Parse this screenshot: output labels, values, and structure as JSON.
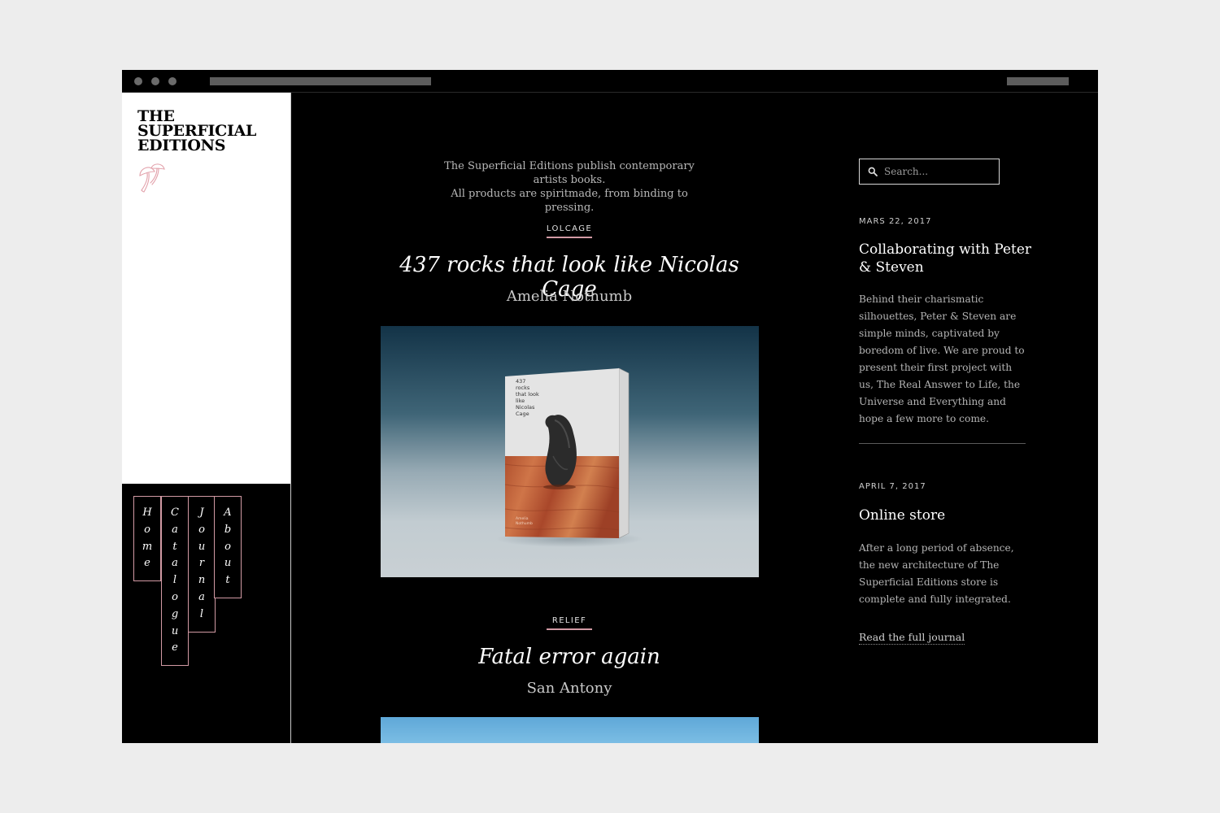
{
  "brand": {
    "logo_lines": [
      "THE",
      "SUPERFICIAL",
      "EDITIONS"
    ]
  },
  "nav": [
    {
      "label": "Home",
      "letters": [
        "H",
        "o",
        "m",
        "e"
      ]
    },
    {
      "label": "Catalogue",
      "letters": [
        "C",
        "a",
        "t",
        "a",
        "l",
        "o",
        "g",
        "u",
        "e"
      ]
    },
    {
      "label": "Journal",
      "letters": [
        "J",
        "o",
        "u",
        "r",
        "n",
        "a",
        "l"
      ]
    },
    {
      "label": "About",
      "letters": [
        "A",
        "b",
        "o",
        "u",
        "t"
      ]
    }
  ],
  "intro": {
    "line1": "The Superficial Editions publish contemporary artists books.",
    "line2": "All products are spiritmade, from binding to pressing."
  },
  "books": [
    {
      "category": "LOLCAGE",
      "title": "437 rocks that look like Nicolas Cage",
      "author": "Amelia Nothumb",
      "cover": {
        "lines": [
          "437",
          "rocks",
          "that look",
          "like",
          "Nicolas",
          "Cage"
        ],
        "author_lines": [
          "Amelia",
          "Nothumb"
        ]
      }
    },
    {
      "category": "RELIEF",
      "title": "Fatal error again",
      "author": "San Antony"
    }
  ],
  "search": {
    "placeholder": "Search..."
  },
  "journal": {
    "entries": [
      {
        "date": "MARS 22, 2017",
        "title": "Collaborating with Peter & Steven",
        "body": "Behind their charismatic silhouettes, Peter & Steven are simple minds, captivated by boredom of live. We are proud to present their first project with us, The Real Answer to Life, the Universe and Everything and hope a few more to come."
      },
      {
        "date": "APRIL 7, 2017",
        "title": "Online store",
        "body": "After a long period of absence, the new architecture of The Superficial Editions store is complete and fully integrated."
      }
    ],
    "read_more": "Read the full journal"
  },
  "colors": {
    "accent": "#d29aa4",
    "background": "#000000",
    "frame": "#ededed"
  }
}
